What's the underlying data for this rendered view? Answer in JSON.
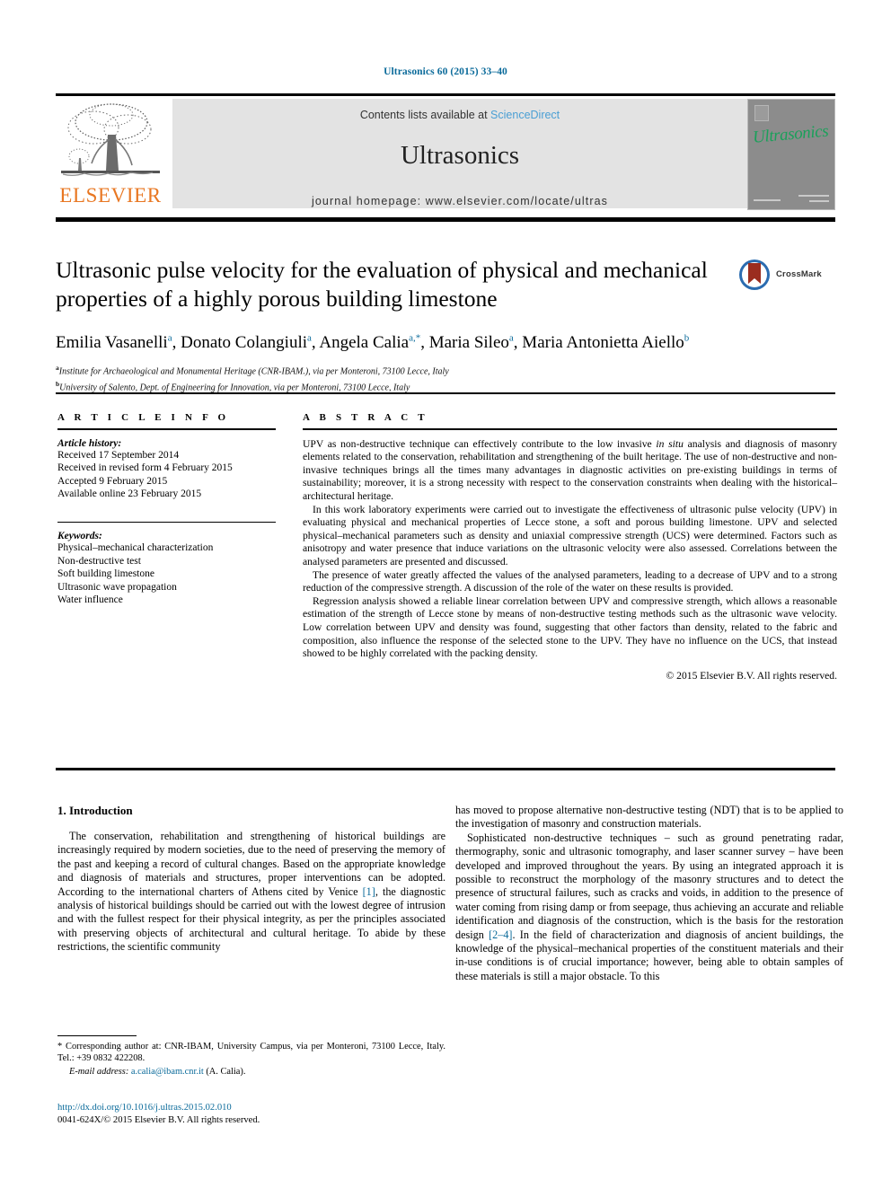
{
  "running_head": "Ultrasonics 60 (2015) 33–40",
  "masthead": {
    "publisher_name": "ELSEVIER",
    "contents_prefix": "Contents lists available at ",
    "contents_link": "ScienceDirect",
    "journal_name": "Ultrasonics",
    "homepage": "journal homepage: www.elsevier.com/locate/ultras",
    "cover_title": "Ultrasonics"
  },
  "article": {
    "title": "Ultrasonic pulse velocity for the evaluation of physical and mechanical properties of a highly porous building limestone",
    "crossmark_label": "CrossMark",
    "authors": [
      {
        "name": "Emilia Vasanelli",
        "marks": "a",
        "sep": ", "
      },
      {
        "name": "Donato Colangiuli",
        "marks": "a",
        "sep": ", "
      },
      {
        "name": "Angela Calia",
        "marks": "a,*",
        "sep": ", "
      },
      {
        "name": "Maria Sileo",
        "marks": "a",
        "sep": ", "
      },
      {
        "name": "Maria Antonietta Aiello",
        "marks": "b",
        "sep": ""
      }
    ],
    "affiliations": [
      {
        "mark": "a",
        "text": "Institute for Archaeological and Monumental Heritage (CNR-IBAM.), via per Monteroni, 73100 Lecce, Italy"
      },
      {
        "mark": "b",
        "text": "University of Salento, Dept. of Engineering for Innovation, via per Monteroni, 73100 Lecce, Italy"
      }
    ]
  },
  "info": {
    "label": "A R T I C L E   I N F O",
    "history_heading": "Article history:",
    "history": [
      "Received 17 September 2014",
      "Received in revised form 4 February 2015",
      "Accepted 9 February 2015",
      "Available online 23 February 2015"
    ],
    "keywords_heading": "Keywords:",
    "keywords": [
      "Physical–mechanical characterization",
      "Non-destructive test",
      "Soft building limestone",
      "Ultrasonic wave propagation",
      "Water influence"
    ]
  },
  "abstract": {
    "label": "A B S T R A C T",
    "p1_a": "UPV as non-destructive technique can effectively contribute to the low invasive ",
    "p1_it": "in situ",
    "p1_b": " analysis and diagnosis of masonry elements related to the conservation, rehabilitation and strengthening of the built heritage. The use of non-destructive and non-invasive techniques brings all the times many advantages in diagnostic activities on pre-existing buildings in terms of sustainability; moreover, it is a strong necessity with respect to the conservation constraints when dealing with the historical–architectural heritage.",
    "p2": "In this work laboratory experiments were carried out to investigate the effectiveness of ultrasonic pulse velocity (UPV) in evaluating physical and mechanical properties of Lecce stone, a soft and porous building limestone. UPV and selected physical–mechanical parameters such as density and uniaxial compressive strength (UCS) were determined. Factors such as anisotropy and water presence that induce variations on the ultrasonic velocity were also assessed. Correlations between the analysed parameters are presented and discussed.",
    "p3": "The presence of water greatly affected the values of the analysed parameters, leading to a decrease of UPV and to a strong reduction of the compressive strength. A discussion of the role of the water on these results is provided.",
    "p4": "Regression analysis showed a reliable linear correlation between UPV and compressive strength, which allows a reasonable estimation of the strength of Lecce stone by means of non-destructive testing methods such as the ultrasonic wave velocity. Low correlation between UPV and density was found, suggesting that other factors than density, related to the fabric and composition, also influence the response of the selected stone to the UPV. They have no influence on the UCS, that instead showed to be highly correlated with the packing density.",
    "copyright": "© 2015 Elsevier B.V. All rights reserved."
  },
  "introduction": {
    "heading": "1. Introduction",
    "left_a": "The conservation, rehabilitation and strengthening of historical buildings are increasingly required by modern societies, due to the need of preserving the memory of the past and keeping a record of cultural changes. Based on the appropriate knowledge and diagnosis of materials and structures, proper interventions can be adopted. According to the international charters of Athens cited by Venice ",
    "left_ref": "[1]",
    "left_b": ", the diagnostic analysis of historical buildings should be carried out with the lowest degree of intrusion and with the fullest respect for their physical integrity, as per the principles associated with preserving objects of architectural and cultural heritage. To abide by these restrictions, the scientific community",
    "right_p1": "has moved to propose alternative non-destructive testing (NDT) that is to be applied to the investigation of masonry and construction materials.",
    "right_p2_a": "Sophisticated non-destructive techniques – such as ground penetrating radar, thermography, sonic and ultrasonic tomography, and laser scanner survey – have been developed and improved throughout the years. By using an integrated approach it is possible to reconstruct the morphology of the masonry structures and to detect the presence of structural failures, such as cracks and voids, in addition to the presence of water coming from rising damp or from seepage, thus achieving an accurate and reliable identification and diagnosis of the construction, which is the basis for the restoration design ",
    "right_ref": "[2–4]",
    "right_p2_b": ". In the field of characterization and diagnosis of ancient buildings, the knowledge of the physical–mechanical properties of the constituent materials and their in-use conditions is of crucial importance; however, being able to obtain samples of these materials is still a major obstacle. To this"
  },
  "footnotes": {
    "corresponding": "* Corresponding author at: CNR-IBAM, University Campus, via per Monteroni, 73100 Lecce, Italy. Tel.: +39 0832 422208.",
    "email_label": "E-mail address:",
    "email": "a.calia@ibam.cnr.it",
    "email_suffix": " (A. Calia).",
    "doi": "http://dx.doi.org/10.1016/j.ultras.2015.02.010",
    "issn_line": "0041-624X/© 2015 Elsevier B.V. All rights reserved."
  },
  "colors": {
    "link_blue": "#0a6a9a",
    "science_direct_blue": "#4a9fd4",
    "elsevier_orange": "#e87722",
    "cover_green": "#1aa05a",
    "cover_gray": "#8c8c8c",
    "band_gray": "#e3e3e3"
  }
}
